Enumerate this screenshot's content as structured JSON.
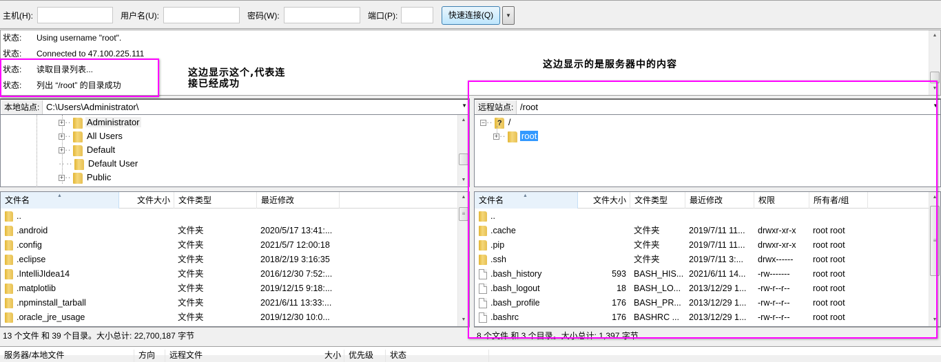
{
  "quickconnect": {
    "host_label": "主机(H):",
    "host_value": "",
    "user_label": "用户名(U):",
    "user_value": "",
    "pass_label": "密码(W):",
    "pass_value": "",
    "port_label": "端口(P):",
    "port_value": "",
    "connect_button": "快速连接(Q)",
    "dropdown_icon": "chevron-down-icon"
  },
  "log": [
    {
      "key": "状态:",
      "msg": "Using username \"root\"."
    },
    {
      "key": "状态:",
      "msg": "Connected to 47.100.225.111"
    },
    {
      "key": "状态:",
      "msg": "读取目录列表..."
    },
    {
      "key": "状态:",
      "msg": "列出 “/root” 的目录成功"
    }
  ],
  "annotations": {
    "left_note_line1": "这边显示这个,代表连",
    "left_note_line2": "接已经成功",
    "right_note": "这边显示的是服务器中的内容",
    "highlight_color": "#ff00ff"
  },
  "local": {
    "site_label": "本地站点:",
    "path": "C:\\Users\\Administrator\\",
    "tree": [
      {
        "label": "Administrator",
        "expandable": true,
        "icon": "user-folder-icon"
      },
      {
        "label": "All Users",
        "expandable": true,
        "icon": "folder-icon"
      },
      {
        "label": "Default",
        "expandable": true,
        "icon": "folder-icon"
      },
      {
        "label": "Default User",
        "expandable": false,
        "icon": "folder-icon"
      },
      {
        "label": "Public",
        "expandable": true,
        "icon": "folder-icon"
      }
    ],
    "columns": [
      "文件名",
      "文件大小",
      "文件类型",
      "最近修改"
    ],
    "files": [
      {
        "name": "..",
        "size": "",
        "type": "",
        "modified": "",
        "kind": "folder"
      },
      {
        "name": ".android",
        "size": "",
        "type": "文件夹",
        "modified": "2020/5/17 13:41:...",
        "kind": "folder"
      },
      {
        "name": ".config",
        "size": "",
        "type": "文件夹",
        "modified": "2021/5/7 12:00:18",
        "kind": "folder"
      },
      {
        "name": ".eclipse",
        "size": "",
        "type": "文件夹",
        "modified": "2018/2/19 3:16:35",
        "kind": "folder"
      },
      {
        "name": ".IntelliJIdea14",
        "size": "",
        "type": "文件夹",
        "modified": "2016/12/30 7:52:...",
        "kind": "folder"
      },
      {
        "name": ".matplotlib",
        "size": "",
        "type": "文件夹",
        "modified": "2019/12/15 9:18:...",
        "kind": "folder"
      },
      {
        "name": ".npminstall_tarball",
        "size": "",
        "type": "文件夹",
        "modified": "2021/6/11 13:33:...",
        "kind": "folder"
      },
      {
        "name": ".oracle_jre_usage",
        "size": "",
        "type": "文件夹",
        "modified": "2019/12/30 10:0...",
        "kind": "folder"
      }
    ],
    "status": "13 个文件 和 39 个目录。大小总计: 22,700,187 字节"
  },
  "remote": {
    "site_label": "远程站点:",
    "path": "/root",
    "tree": [
      {
        "label": "/",
        "expandable": true,
        "expanded": true,
        "icon": "unknown-folder-icon"
      },
      {
        "label": "root",
        "expandable": true,
        "selected": true,
        "icon": "folder-icon"
      }
    ],
    "columns": [
      "文件名",
      "文件大小",
      "文件类型",
      "最近修改",
      "权限",
      "所有者/组"
    ],
    "files": [
      {
        "name": "..",
        "size": "",
        "type": "",
        "modified": "",
        "perms": "",
        "owner": "",
        "kind": "folder"
      },
      {
        "name": ".cache",
        "size": "",
        "type": "文件夹",
        "modified": "2019/7/11 11...",
        "perms": "drwxr-xr-x",
        "owner": "root root",
        "kind": "folder"
      },
      {
        "name": ".pip",
        "size": "",
        "type": "文件夹",
        "modified": "2019/7/11 11...",
        "perms": "drwxr-xr-x",
        "owner": "root root",
        "kind": "folder"
      },
      {
        "name": ".ssh",
        "size": "",
        "type": "文件夹",
        "modified": "2019/7/11 3:...",
        "perms": "drwx------",
        "owner": "root root",
        "kind": "folder"
      },
      {
        "name": ".bash_history",
        "size": "593",
        "type": "BASH_HIS...",
        "modified": "2021/6/11 14...",
        "perms": "-rw-------",
        "owner": "root root",
        "kind": "file"
      },
      {
        "name": ".bash_logout",
        "size": "18",
        "type": "BASH_LO...",
        "modified": "2013/12/29 1...",
        "perms": "-rw-r--r--",
        "owner": "root root",
        "kind": "file"
      },
      {
        "name": ".bash_profile",
        "size": "176",
        "type": "BASH_PR...",
        "modified": "2013/12/29 1...",
        "perms": "-rw-r--r--",
        "owner": "root root",
        "kind": "file"
      },
      {
        "name": ".bashrc",
        "size": "176",
        "type": "BASHRC ...",
        "modified": "2013/12/29 1...",
        "perms": "-rw-r--r--",
        "owner": "root root",
        "kind": "file"
      }
    ],
    "status": "8 个文件 和 3 个目录。大小总计: 1,397 字节"
  },
  "queue": {
    "columns": [
      "服务器/本地文件",
      "方向",
      "远程文件",
      "大小",
      "优先级",
      "状态"
    ]
  }
}
